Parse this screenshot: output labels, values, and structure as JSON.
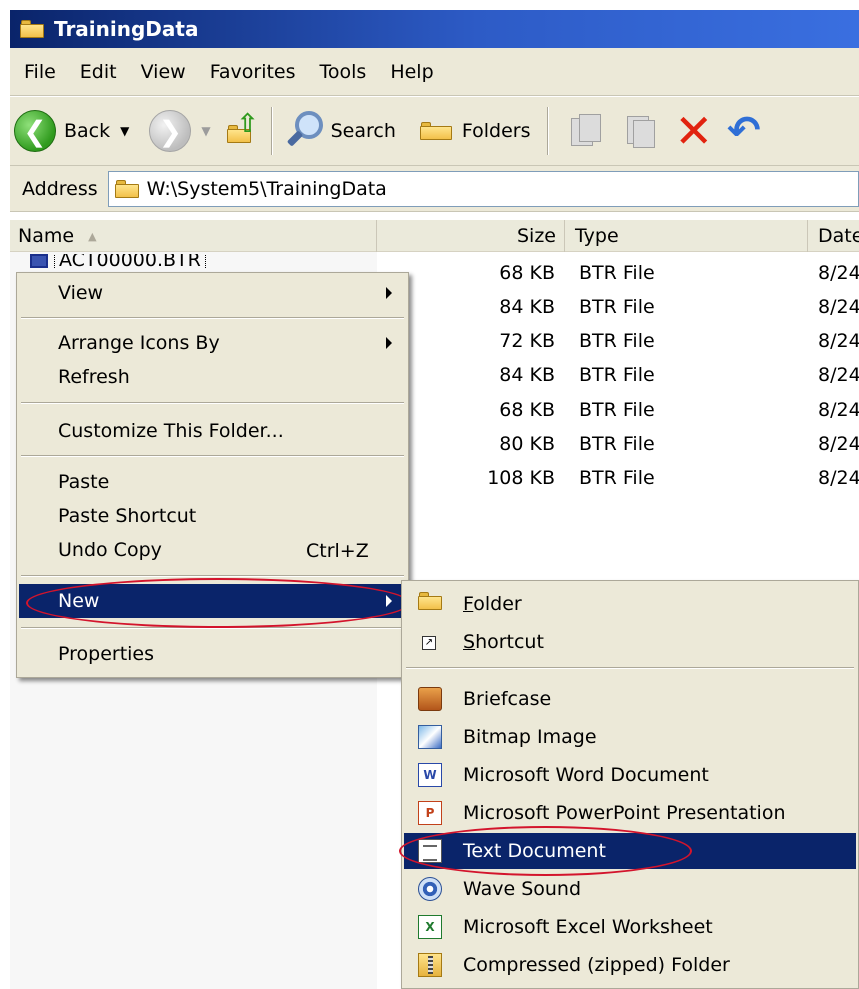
{
  "window": {
    "title": "TrainingData"
  },
  "menubar": {
    "items": [
      "File",
      "Edit",
      "View",
      "Favorites",
      "Tools",
      "Help"
    ]
  },
  "toolbar": {
    "back_label": "Back",
    "search_label": "Search",
    "folders_label": "Folders"
  },
  "address": {
    "label": "Address",
    "value": "W:\\System5\\TrainingData"
  },
  "columns": {
    "name": "Name",
    "size": "Size",
    "type": "Type",
    "date": "Date"
  },
  "files": [
    {
      "name": "ACT00000.BTR",
      "size": "68 KB",
      "type": "BTR File",
      "date": "8/24"
    },
    {
      "size": "84 KB",
      "type": "BTR File",
      "date": "8/24"
    },
    {
      "size": "72 KB",
      "type": "BTR File",
      "date": "8/24"
    },
    {
      "size": "84 KB",
      "type": "BTR File",
      "date": "8/24"
    },
    {
      "size": "68 KB",
      "type": "BTR File",
      "date": "8/24"
    },
    {
      "size": "80 KB",
      "type": "BTR File",
      "date": "8/24"
    },
    {
      "size": "108 KB",
      "type": "BTR File",
      "date": "8/24"
    }
  ],
  "context_menu": {
    "view": "View",
    "arrange": "Arrange Icons By",
    "refresh": "Refresh",
    "customize": "Customize This Folder...",
    "paste": "Paste",
    "paste_shortcut": "Paste Shortcut",
    "undo_copy": "Undo Copy",
    "undo_shortcut": "Ctrl+Z",
    "new": "New",
    "properties": "Properties"
  },
  "new_submenu": {
    "folder": {
      "accel": "F",
      "rest": "older"
    },
    "shortcut": {
      "accel": "S",
      "rest": "hortcut"
    },
    "briefcase": "Briefcase",
    "bitmap": "Bitmap Image",
    "word": "Microsoft Word Document",
    "powerpoint": "Microsoft PowerPoint Presentation",
    "text": "Text Document",
    "wave": "Wave Sound",
    "excel": "Microsoft Excel Worksheet",
    "zip": "Compressed (zipped) Folder"
  },
  "colors": {
    "selection": "#0a246a",
    "highlight_oval": "#d3142c",
    "menu_bg": "#ece9d8"
  },
  "icons": [
    "folder-icon",
    "back-icon",
    "forward-icon",
    "up-icon",
    "search-icon",
    "folders-icon",
    "move-to-icon",
    "copy-to-icon",
    "delete-icon",
    "undo-icon"
  ]
}
